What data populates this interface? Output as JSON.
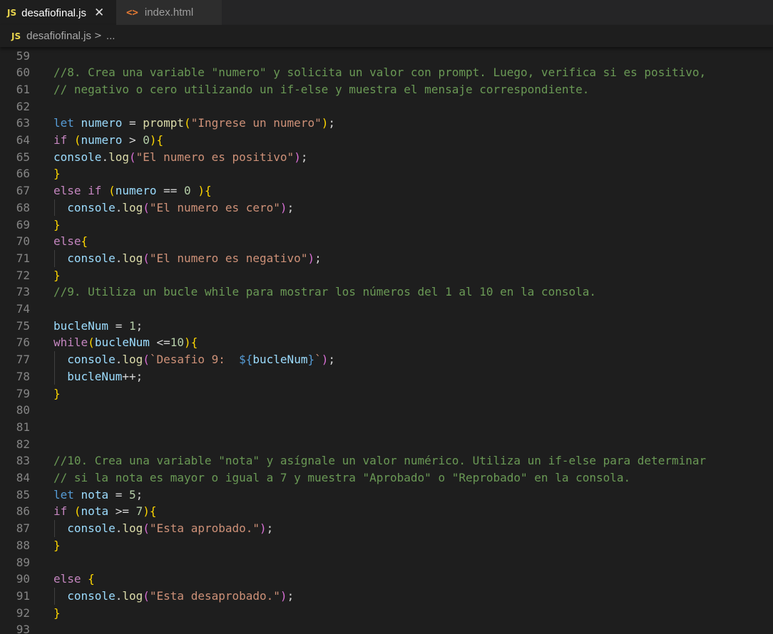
{
  "tabs": [
    {
      "icon": "JS",
      "label": "desafiofinal.js",
      "active": true,
      "close": "✕"
    },
    {
      "icon": "<>",
      "label": "index.html",
      "active": false
    }
  ],
  "breadcrumb": {
    "icon": "JS",
    "file": "desafiofinal.js",
    "separator": ">",
    "more": "..."
  },
  "colors": {
    "editor_bg": "#1e1e1e",
    "tab_bg": "#252526",
    "comment": "#6a9955",
    "keyword": "#569cd6",
    "control": "#c586c0",
    "variable": "#9cdcfe",
    "function": "#dcdcaa",
    "string": "#ce9178",
    "number": "#b5cea8",
    "bracket": "#ffd700"
  },
  "code": [
    {
      "n": "59",
      "t": []
    },
    {
      "n": "60",
      "t": [
        [
          "cmt",
          "//8. Crea una variable \"numero\" y solicita un valor con prompt. Luego, verifica si es positivo,"
        ]
      ]
    },
    {
      "n": "61",
      "t": [
        [
          "cmt",
          "// negativo o cero utilizando un if-else y muestra el mensaje correspondiente."
        ]
      ]
    },
    {
      "n": "62",
      "t": []
    },
    {
      "n": "63",
      "t": [
        [
          "kw",
          "let"
        ],
        [
          "op",
          " "
        ],
        [
          "var",
          "numero"
        ],
        [
          "op",
          " = "
        ],
        [
          "fn",
          "prompt"
        ],
        [
          "p1",
          "("
        ],
        [
          "str",
          "\"Ingrese un numero\""
        ],
        [
          "p1",
          ")"
        ],
        [
          "op",
          ";"
        ]
      ]
    },
    {
      "n": "64",
      "t": [
        [
          "ctl",
          "if"
        ],
        [
          "op",
          " "
        ],
        [
          "p1",
          "("
        ],
        [
          "var",
          "numero"
        ],
        [
          "op",
          " > "
        ],
        [
          "num",
          "0"
        ],
        [
          "p1",
          ")"
        ],
        [
          "p1",
          "{"
        ]
      ]
    },
    {
      "n": "65",
      "t": [
        [
          "var",
          "console"
        ],
        [
          "op",
          "."
        ],
        [
          "fn",
          "log"
        ],
        [
          "p2",
          "("
        ],
        [
          "str",
          "\"El numero es positivo\""
        ],
        [
          "p2",
          ")"
        ],
        [
          "op",
          ";"
        ]
      ]
    },
    {
      "n": "66",
      "t": [
        [
          "p1",
          "}"
        ]
      ]
    },
    {
      "n": "67",
      "t": [
        [
          "ctl",
          "else"
        ],
        [
          "op",
          " "
        ],
        [
          "ctl",
          "if"
        ],
        [
          "op",
          " "
        ],
        [
          "p1",
          "("
        ],
        [
          "var",
          "numero"
        ],
        [
          "op",
          " == "
        ],
        [
          "num",
          "0"
        ],
        [
          "op",
          " "
        ],
        [
          "p1",
          ")"
        ],
        [
          "p1",
          "{"
        ]
      ]
    },
    {
      "n": "68",
      "t": [
        [
          "op",
          "  "
        ],
        [
          "var",
          "console"
        ],
        [
          "op",
          "."
        ],
        [
          "fn",
          "log"
        ],
        [
          "p2",
          "("
        ],
        [
          "str",
          "\"El numero es cero\""
        ],
        [
          "p2",
          ")"
        ],
        [
          "op",
          ";"
        ]
      ]
    },
    {
      "n": "69",
      "t": [
        [
          "p1",
          "}"
        ]
      ]
    },
    {
      "n": "70",
      "t": [
        [
          "ctl",
          "else"
        ],
        [
          "p1",
          "{"
        ]
      ]
    },
    {
      "n": "71",
      "t": [
        [
          "op",
          "  "
        ],
        [
          "var",
          "console"
        ],
        [
          "op",
          "."
        ],
        [
          "fn",
          "log"
        ],
        [
          "p2",
          "("
        ],
        [
          "str",
          "\"El numero es negativo\""
        ],
        [
          "p2",
          ")"
        ],
        [
          "op",
          ";"
        ]
      ]
    },
    {
      "n": "72",
      "t": [
        [
          "p1",
          "}"
        ]
      ]
    },
    {
      "n": "73",
      "t": [
        [
          "cmt",
          "//9. Utiliza un bucle while para mostrar los números del 1 al 10 en la consola."
        ]
      ]
    },
    {
      "n": "74",
      "t": []
    },
    {
      "n": "75",
      "t": [
        [
          "var",
          "bucleNum"
        ],
        [
          "op",
          " = "
        ],
        [
          "num",
          "1"
        ],
        [
          "op",
          ";"
        ]
      ]
    },
    {
      "n": "76",
      "t": [
        [
          "ctl",
          "while"
        ],
        [
          "p1",
          "("
        ],
        [
          "var",
          "bucleNum"
        ],
        [
          "op",
          " <="
        ],
        [
          "num",
          "10"
        ],
        [
          "p1",
          ")"
        ],
        [
          "p1",
          "{"
        ]
      ]
    },
    {
      "n": "77",
      "t": [
        [
          "op",
          "  "
        ],
        [
          "var",
          "console"
        ],
        [
          "op",
          "."
        ],
        [
          "fn",
          "log"
        ],
        [
          "p2",
          "("
        ],
        [
          "str",
          "`Desafio 9:  "
        ],
        [
          "tpl",
          "${"
        ],
        [
          "var",
          "bucleNum"
        ],
        [
          "tpl",
          "}"
        ],
        [
          "str",
          "`"
        ],
        [
          "p2",
          ")"
        ],
        [
          "op",
          ";"
        ]
      ]
    },
    {
      "n": "78",
      "t": [
        [
          "op",
          "  "
        ],
        [
          "var",
          "bucleNum"
        ],
        [
          "op",
          "++;"
        ]
      ]
    },
    {
      "n": "79",
      "t": [
        [
          "p1",
          "}"
        ]
      ]
    },
    {
      "n": "80",
      "t": []
    },
    {
      "n": "81",
      "t": []
    },
    {
      "n": "82",
      "t": []
    },
    {
      "n": "83",
      "t": [
        [
          "cmt",
          "//10. Crea una variable \"nota\" y asígnale un valor numérico. Utiliza un if-else para determinar"
        ]
      ]
    },
    {
      "n": "84",
      "t": [
        [
          "cmt",
          "// si la nota es mayor o igual a 7 y muestra \"Aprobado\" o \"Reprobado\" en la consola."
        ]
      ]
    },
    {
      "n": "85",
      "t": [
        [
          "kw",
          "let"
        ],
        [
          "op",
          " "
        ],
        [
          "var",
          "nota"
        ],
        [
          "op",
          " = "
        ],
        [
          "num",
          "5"
        ],
        [
          "op",
          ";"
        ]
      ]
    },
    {
      "n": "86",
      "t": [
        [
          "ctl",
          "if"
        ],
        [
          "op",
          " "
        ],
        [
          "p1",
          "("
        ],
        [
          "var",
          "nota"
        ],
        [
          "op",
          " >= "
        ],
        [
          "num",
          "7"
        ],
        [
          "p1",
          ")"
        ],
        [
          "p1",
          "{"
        ]
      ]
    },
    {
      "n": "87",
      "t": [
        [
          "op",
          "  "
        ],
        [
          "var",
          "console"
        ],
        [
          "op",
          "."
        ],
        [
          "fn",
          "log"
        ],
        [
          "p2",
          "("
        ],
        [
          "str",
          "\"Esta aprobado.\""
        ],
        [
          "p2",
          ")"
        ],
        [
          "op",
          ";"
        ]
      ]
    },
    {
      "n": "88",
      "t": [
        [
          "p1",
          "}"
        ]
      ]
    },
    {
      "n": "89",
      "t": []
    },
    {
      "n": "90",
      "t": [
        [
          "ctl",
          "else"
        ],
        [
          "op",
          " "
        ],
        [
          "p1",
          "{"
        ]
      ]
    },
    {
      "n": "91",
      "t": [
        [
          "op",
          "  "
        ],
        [
          "var",
          "console"
        ],
        [
          "op",
          "."
        ],
        [
          "fn",
          "log"
        ],
        [
          "p2",
          "("
        ],
        [
          "str",
          "\"Esta desaprobado.\""
        ],
        [
          "p2",
          ")"
        ],
        [
          "op",
          ";"
        ]
      ]
    },
    {
      "n": "92",
      "t": [
        [
          "p1",
          "}"
        ]
      ]
    },
    {
      "n": "93",
      "t": []
    }
  ]
}
